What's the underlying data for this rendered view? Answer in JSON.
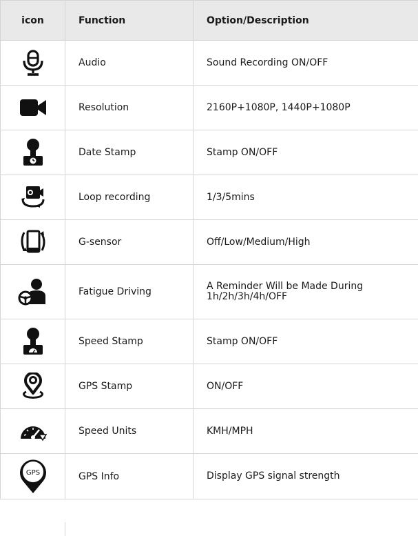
{
  "header": {
    "icon": "icon",
    "function": "Function",
    "option": "Option/Description"
  },
  "rows": [
    {
      "icon": "microphone-icon",
      "function": "Audio",
      "option": "Sound Recording ON/OFF"
    },
    {
      "icon": "video-camera-icon",
      "function": "Resolution",
      "option": "2160P+1080P, 1440P+1080P"
    },
    {
      "icon": "date-stamp-icon",
      "function": "Date Stamp",
      "option": "Stamp ON/OFF"
    },
    {
      "icon": "loop-recording-icon",
      "function": "Loop recording",
      "option": "1/3/5mins"
    },
    {
      "icon": "g-sensor-icon",
      "function": "G-sensor",
      "option": "Off/Low/Medium/High"
    },
    {
      "icon": "fatigue-driving-icon",
      "function": "Fatigue Driving",
      "option": "A Reminder Will be Made During 1h/2h/3h/4h/OFF"
    },
    {
      "icon": "speed-stamp-icon",
      "function": "Speed Stamp",
      "option": "Stamp ON/OFF"
    },
    {
      "icon": "gps-stamp-icon",
      "function": "GPS Stamp",
      "option": "ON/OFF"
    },
    {
      "icon": "speedometer-icon",
      "function": "Speed Units",
      "option": "KMH/MPH"
    },
    {
      "icon": "gps-info-icon",
      "function": "GPS Info",
      "option": "Display GPS signal strength"
    }
  ],
  "gps_icon_text": "GPS",
  "colors": {
    "header_bg": "#e9e9e9",
    "border": "#d4d4d4",
    "icon": "#111111"
  }
}
